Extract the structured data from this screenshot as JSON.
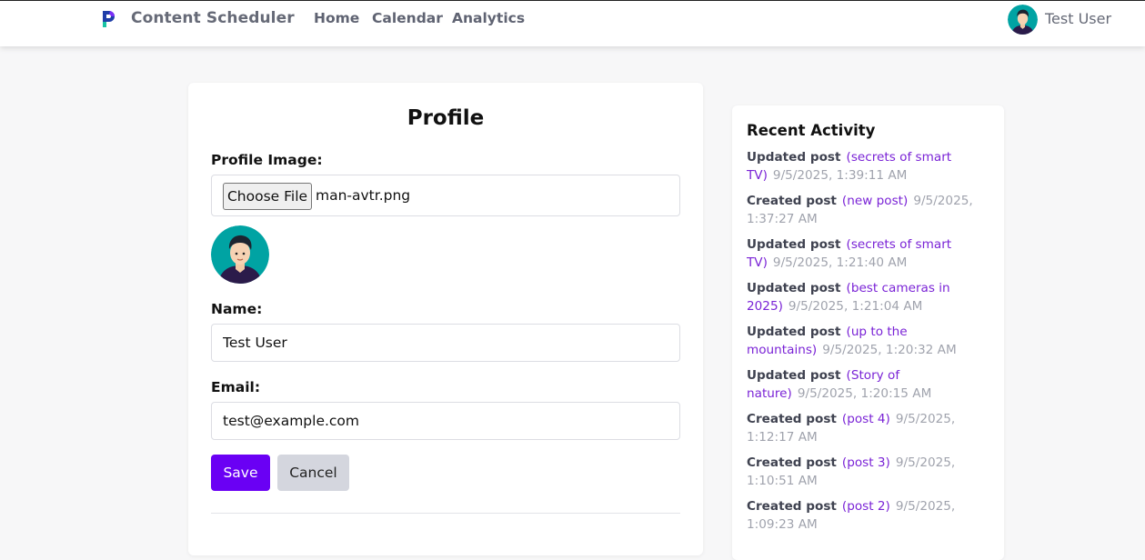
{
  "header": {
    "brand": "Content Scheduler",
    "nav": [
      {
        "label": "Home"
      },
      {
        "label": "Calendar"
      },
      {
        "label": "Analytics"
      }
    ],
    "user_name": "Test User"
  },
  "profile": {
    "title": "Profile",
    "image_label": "Profile Image:",
    "choose_file_label": "Choose File",
    "file_name": "man-avtr.png",
    "name_label": "Name:",
    "name_value": "Test User",
    "email_label": "Email:",
    "email_value": "test@example.com",
    "save_label": "Save",
    "cancel_label": "Cancel"
  },
  "activity": {
    "title": "Recent Activity",
    "items": [
      {
        "action": "Updated post",
        "post": "(secrets of smart TV)",
        "time": "9/5/2025, 1:39:11 AM"
      },
      {
        "action": "Created post",
        "post": "(new post)",
        "time": "9/5/2025, 1:37:27 AM"
      },
      {
        "action": "Updated post",
        "post": "(secrets of smart TV)",
        "time": "9/5/2025, 1:21:40 AM"
      },
      {
        "action": "Updated post",
        "post": "(best cameras in 2025)",
        "time": "9/5/2025, 1:21:04 AM"
      },
      {
        "action": "Updated post",
        "post": "(up to the mountains)",
        "time": "9/5/2025, 1:20:32 AM"
      },
      {
        "action": "Updated post",
        "post": "(Story of nature)",
        "time": "9/5/2025, 1:20:15 AM"
      },
      {
        "action": "Created post",
        "post": "(post 4)",
        "time": "9/5/2025, 1:12:17 AM"
      },
      {
        "action": "Created post",
        "post": "(post 3)",
        "time": "9/5/2025, 1:10:51 AM"
      },
      {
        "action": "Created post",
        "post": "(post 2)",
        "time": "9/5/2025, 1:09:23 AM"
      }
    ]
  },
  "colors": {
    "accent": "#6a00f4",
    "post_link": "#7a23d6",
    "muted_text": "#a0a3ad",
    "cancel_bg": "#d4d6de"
  },
  "icons": {
    "logo": "brand-logo-icon",
    "avatar": "avatar-icon"
  }
}
